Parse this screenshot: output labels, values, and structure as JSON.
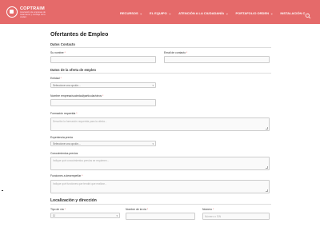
{
  "header": {
    "brand_name": "COPTRAIM",
    "brand_subtitle": "Asociación de empresas de tratamiento y reciclaje de la ciudad",
    "nav": [
      {
        "label": "RECURSOS"
      },
      {
        "label": "EL EQUIPO"
      },
      {
        "label": "ATENCIÓN A LA CIUDADANÍA"
      },
      {
        "label": "PORTAFOLIO ORDEN"
      },
      {
        "label": "INSTALACIÓN C"
      }
    ],
    "search_icon": "search-icon"
  },
  "form": {
    "title": "Ofertantes de Empleo",
    "sections": {
      "contact": "Datos Contacto",
      "offer": "Datos de la oferta de empleo",
      "location": "Localización y dirección"
    },
    "fields": {
      "name_label": "Su nombre",
      "email_label": "Email de contacto",
      "entity_label": "Entidad",
      "entity_value": "Seleccione una opción...",
      "company_label": "Nombre empresa/sociedad/particular/otros",
      "training_label": "Formación requerida",
      "training_placeholder": "Describe la formación requerida para la oferta...",
      "experience_label": "Experiencia previa",
      "experience_value": "Seleccione una opción...",
      "knowledge_label": "Conocimientos previos",
      "knowledge_placeholder": "Indique qué conocimientos previos se requieren...",
      "functions_label": "Funciones a desempeñar",
      "functions_placeholder": "Indique qué funciones que tendrá que realizar...",
      "road_type_label": "Tipo de vía",
      "road_type_value": "C/",
      "road_name_label": "Nombre de la vía",
      "number_label": "Número",
      "number_placeholder": "Número o S/N"
    },
    "required_mark": "*"
  }
}
